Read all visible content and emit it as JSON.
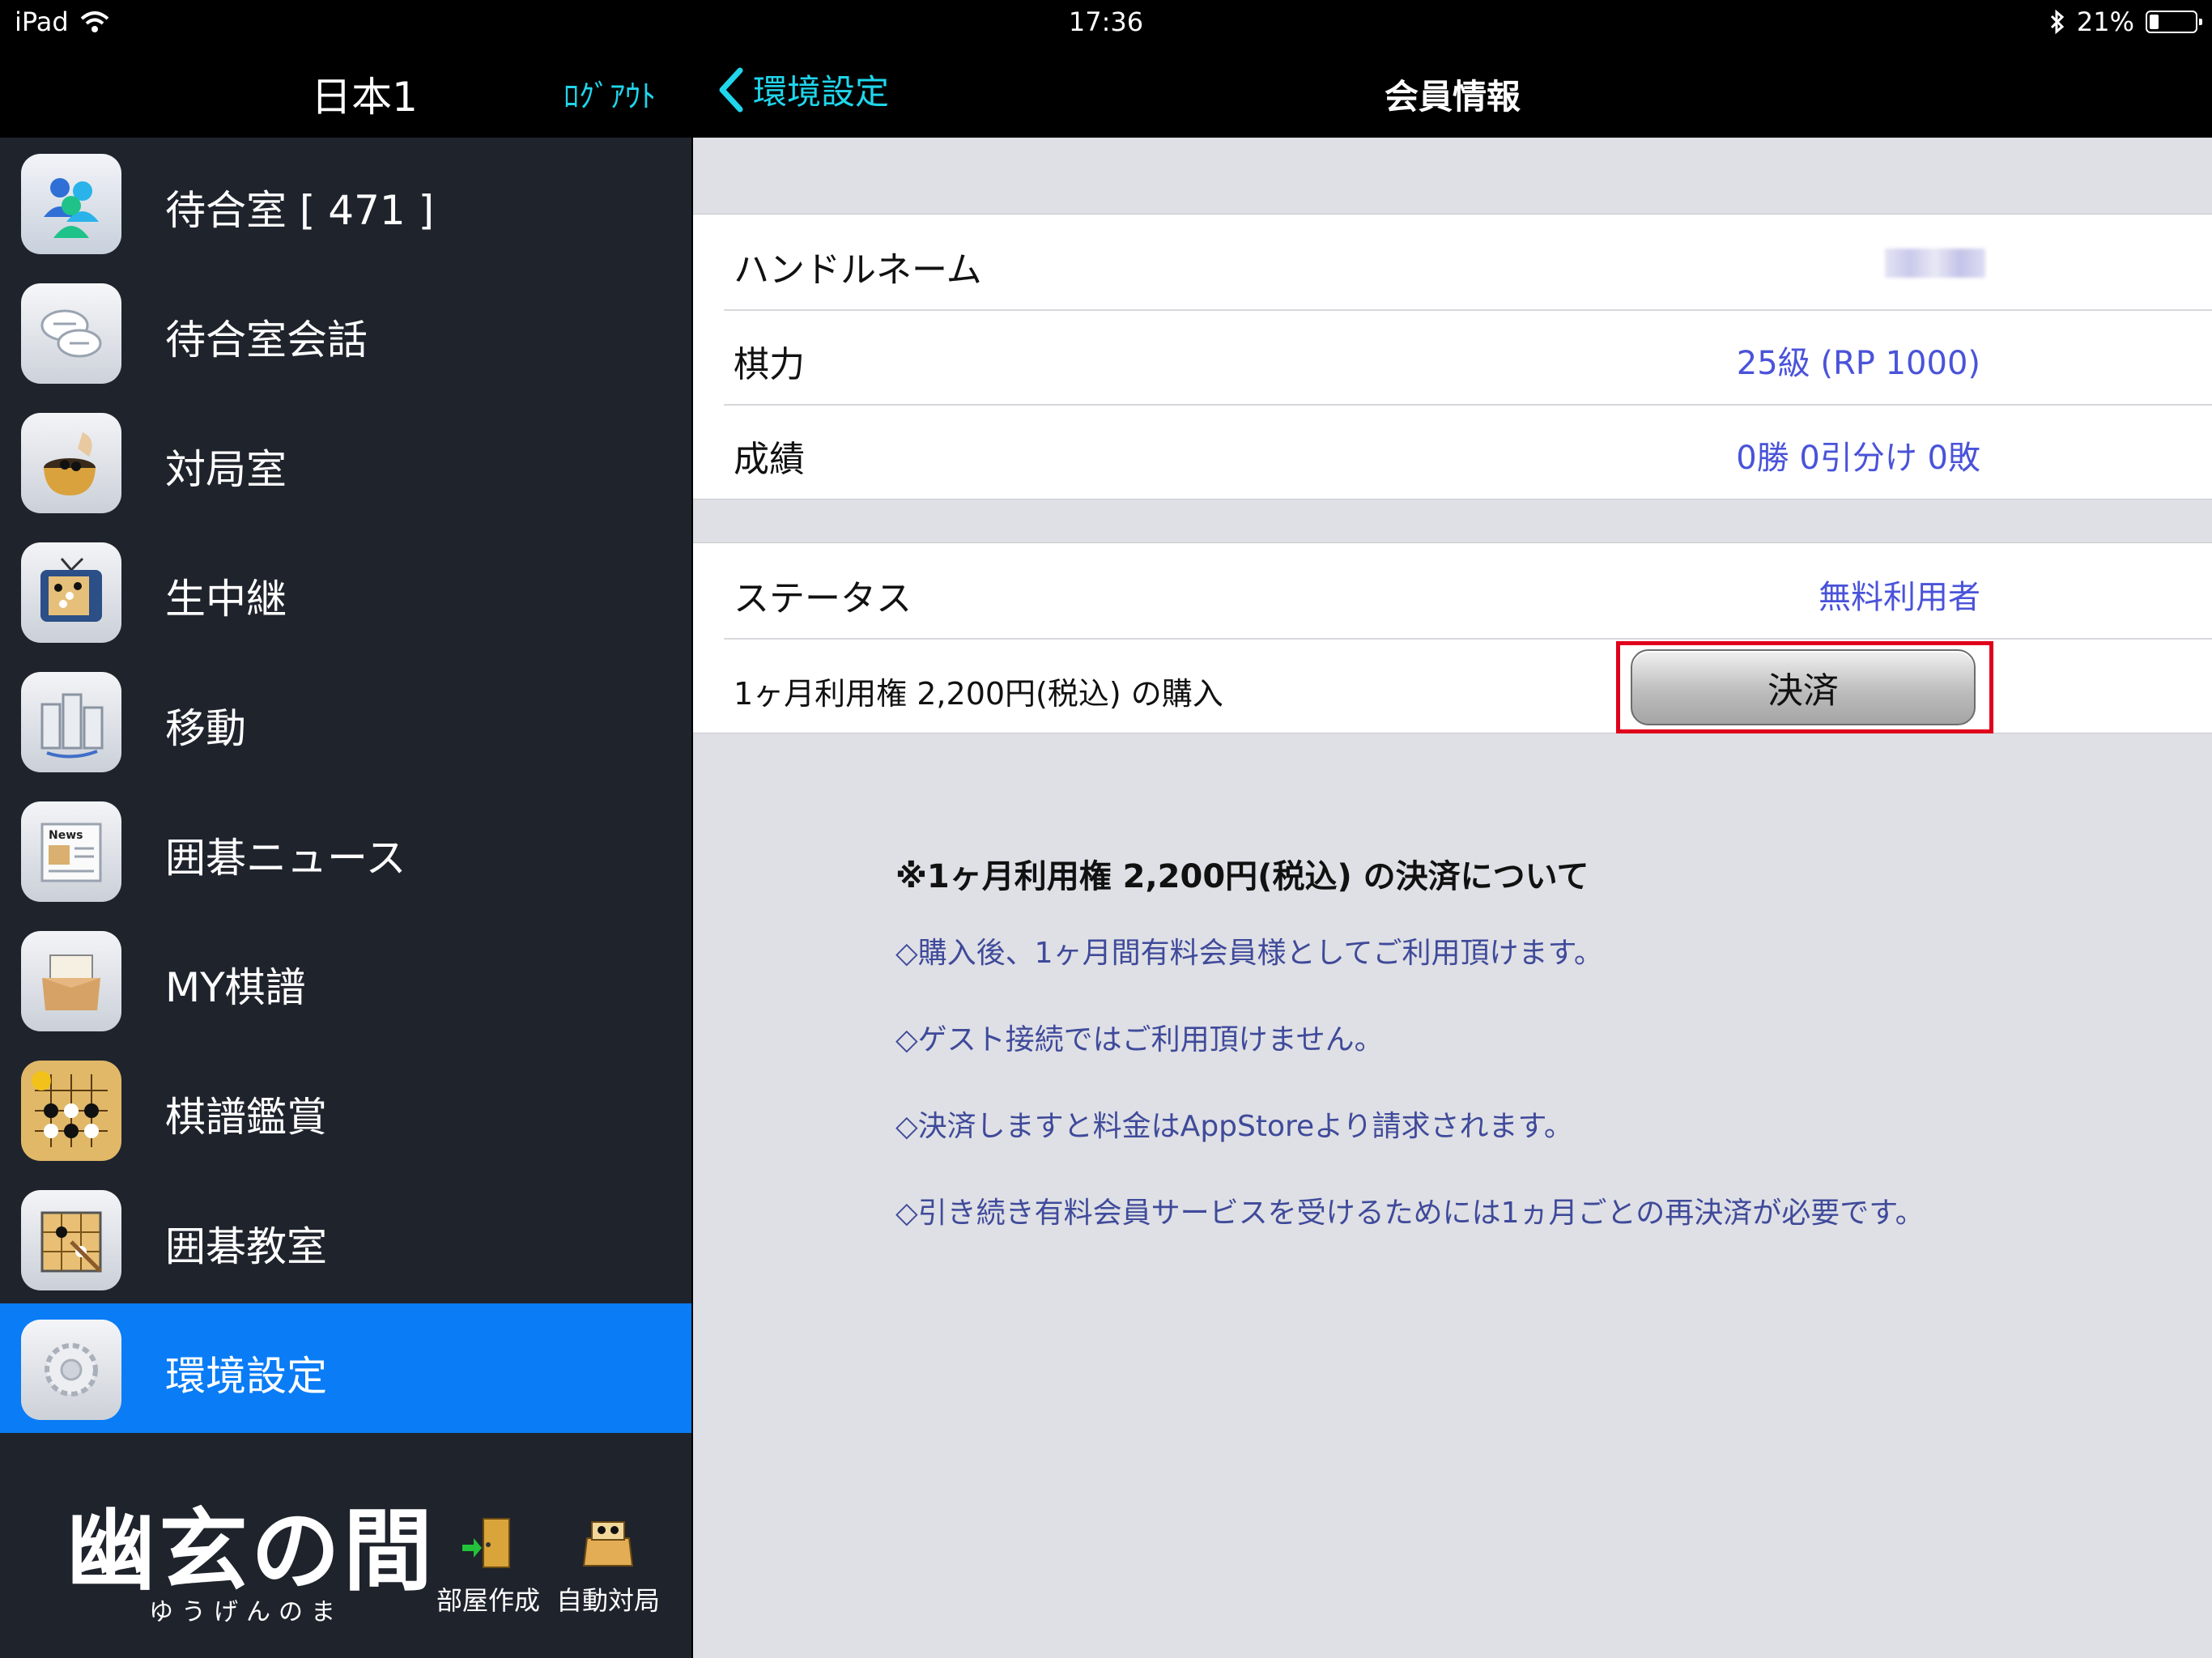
{
  "status_bar": {
    "device": "iPad",
    "time": "17:36",
    "battery": "21%"
  },
  "sidebar": {
    "title": "日本1",
    "logout_label": "ﾛｸﾞｱｳﾄ",
    "items": [
      {
        "label": "待合室 [ 471 ]",
        "icon": "users-icon"
      },
      {
        "label": "待合室会話",
        "icon": "chat-bubbles-icon"
      },
      {
        "label": "対局室",
        "icon": "go-bowl-icon"
      },
      {
        "label": "生中継",
        "icon": "tv-icon"
      },
      {
        "label": "移動",
        "icon": "buildings-icon"
      },
      {
        "label": "囲碁ニュース",
        "icon": "newspaper-icon",
        "icon_text": "News"
      },
      {
        "label": "MY棋譜",
        "icon": "box-icon"
      },
      {
        "label": "棋譜鑑賞",
        "icon": "go-board-icon"
      },
      {
        "label": "囲碁教室",
        "icon": "classroom-board-icon"
      },
      {
        "label": "環境設定",
        "icon": "gear-icon",
        "active": true
      }
    ],
    "logo_main": "幽玄の間",
    "logo_sub": "ゆうげんのま",
    "tools": [
      {
        "label": "部屋作成",
        "icon": "door-exit-icon"
      },
      {
        "label": "自動対局",
        "icon": "auto-match-icon"
      }
    ]
  },
  "navbar": {
    "back_label": "環境設定",
    "title": "会員情報"
  },
  "profile": {
    "handle_label": "ハンドルネーム",
    "rank_label": "棋力",
    "rank_value": "25級 (RP 1000)",
    "record_label": "成績",
    "record_value": "0勝 0引分け 0敗"
  },
  "membership": {
    "status_label": "ステータス",
    "status_value": "無料利用者",
    "purchase_label": "1ヶ月利用権 2,200円(税込) の購入",
    "pay_button": "決済"
  },
  "notice": {
    "title": "※1ヶ月利用権 2,200円(税込) の決済について",
    "lines": [
      "◇購入後、1ヶ月間有料会員様としてご利用頂けます。",
      "◇ゲスト接続ではご利用頂けません。",
      "◇決済しますと料金はAppStoreより請求されます。",
      "◇引き続き有料会員サービスを受けるためには1ヵ月ごとの再決済が必要です。"
    ]
  },
  "colors": {
    "accent": "#1fd6ec",
    "active_item": "#0a7cf6",
    "value_text": "#4a53d9",
    "highlight_frame": "#e0001c"
  }
}
